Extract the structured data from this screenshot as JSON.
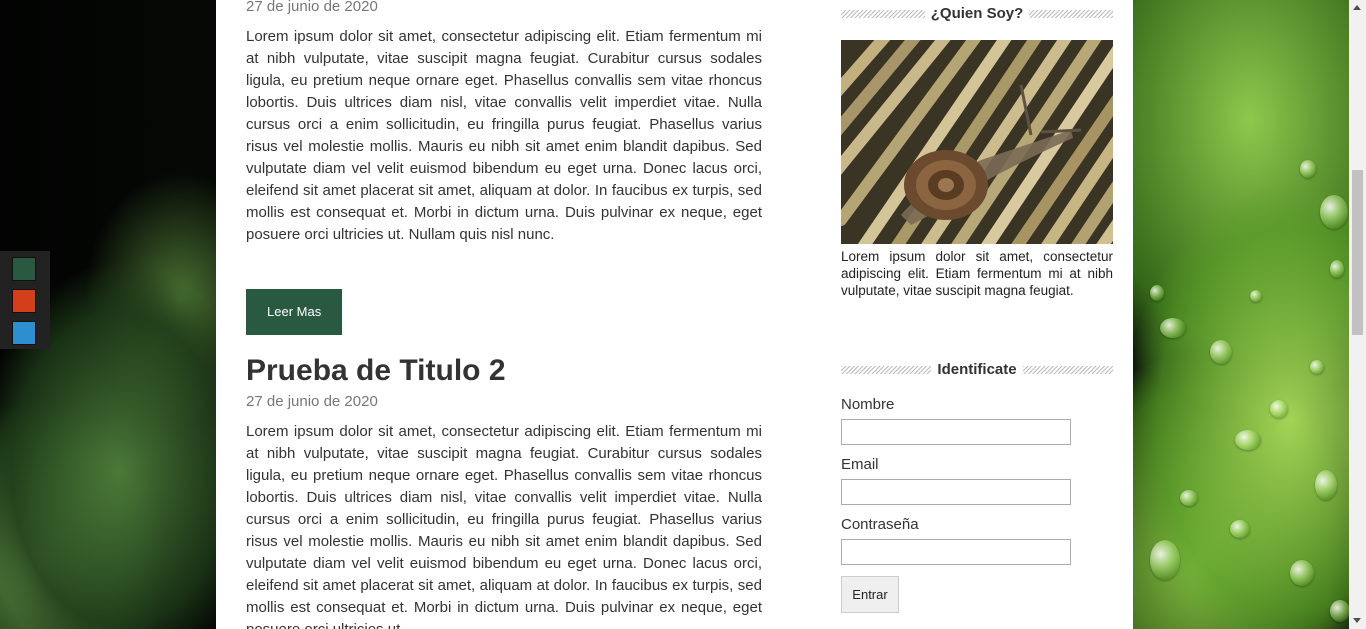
{
  "theme_colors": [
    "#295a41",
    "#d33f1a",
    "#2d8fd0"
  ],
  "posts": [
    {
      "date": "27 de junio de 2020",
      "body": "Lorem ipsum dolor sit amet, consectetur adipiscing elit. Etiam fermentum mi at nibh vulputate, vitae suscipit magna feugiat. Curabitur cursus sodales ligula, eu pretium neque ornare eget. Phasellus convallis sem vitae rhoncus lobortis. Duis ultrices diam nisl, vitae convallis velit imperdiet vitae. Nulla cursus orci a enim sollicitudin, eu fringilla purus feugiat. Phasellus varius risus vel molestie mollis. Mauris eu nibh sit amet enim blandit dapibus. Sed vulputate diam vel velit euismod bibendum eu eget urna. Donec lacus orci, eleifend sit amet placerat sit amet, aliquam at dolor. In faucibus ex turpis, sed mollis est consequat et. Morbi in dictum urna. Duis pulvinar ex neque, eget posuere orci ultricies ut. Nullam quis nisl nunc.",
      "read_more": "Leer Mas"
    },
    {
      "title": "Prueba de Titulo 2",
      "date": "27 de junio de 2020",
      "body": "Lorem ipsum dolor sit amet, consectetur adipiscing elit. Etiam fermentum mi at nibh vulputate, vitae suscipit magna feugiat. Curabitur cursus sodales ligula, eu pretium neque ornare eget. Phasellus convallis sem vitae rhoncus lobortis. Duis ultrices diam nisl, vitae convallis velit imperdiet vitae. Nulla cursus orci a enim sollicitudin, eu fringilla purus feugiat. Phasellus varius risus vel molestie mollis. Mauris eu nibh sit amet enim blandit dapibus. Sed vulputate diam vel velit euismod bibendum eu eget urna. Donec lacus orci, eleifend sit amet placerat sit amet, aliquam at dolor. In faucibus ex turpis, sed mollis est consequat et. Morbi in dictum urna. Duis pulvinar ex neque, eget posuere orci ultricies ut."
    }
  ],
  "sidebar": {
    "about": {
      "heading": "¿Quien Soy?",
      "text": "Lorem ipsum dolor sit amet, consectetur adipiscing elit. Etiam fermentum mi at nibh vulputate, vitae suscipit magna feugiat."
    },
    "login": {
      "heading": "Identificate",
      "name_label": "Nombre",
      "email_label": "Email",
      "password_label": "Contraseña",
      "submit_label": "Entrar"
    }
  }
}
